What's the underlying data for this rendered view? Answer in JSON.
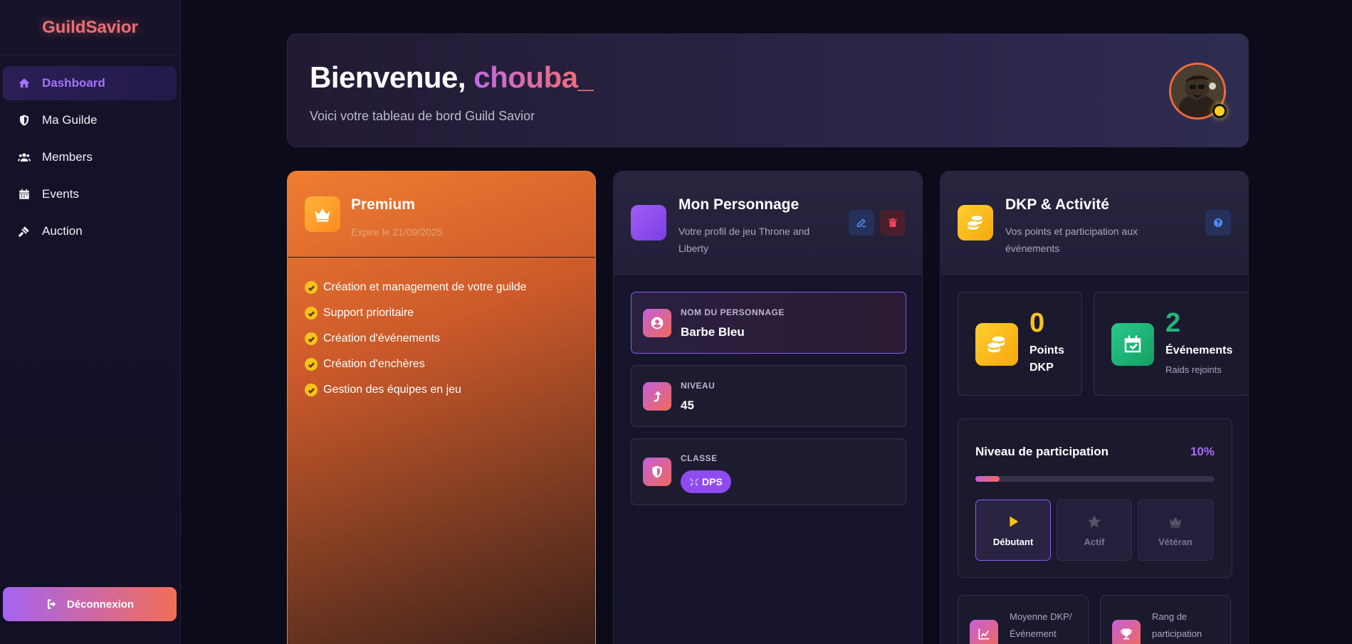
{
  "app": {
    "brand": "GuildSavior"
  },
  "sidebar": {
    "items": [
      {
        "label": "Dashboard",
        "icon": "home-icon",
        "active": true
      },
      {
        "label": "Ma Guilde",
        "icon": "shield-icon"
      },
      {
        "label": "Members",
        "icon": "users-icon"
      },
      {
        "label": "Events",
        "icon": "calendar-icon"
      },
      {
        "label": "Auction",
        "icon": "gavel-icon"
      }
    ],
    "logout_label": "Déconnexion"
  },
  "header": {
    "greeting": "Bienvenue, ",
    "username": "chouba_",
    "subtitle": "Voici votre tableau de bord Guild Savior",
    "status_color": "#f7d21c"
  },
  "premium": {
    "title": "Premium",
    "expiry": "Expire le 21/09/2025",
    "features": [
      "Création et management de votre guilde",
      "Support prioritaire",
      "Création d'événements",
      "Création d'enchères",
      "Gestion des équipes en jeu"
    ]
  },
  "character": {
    "title": "Mon Personnage",
    "subtitle": "Votre profil de jeu Throne and Liberty",
    "name_label": "NOM DU PERSONNAGE",
    "name": "Barbe Bleu",
    "level_label": "NIVEAU",
    "level": "45",
    "class_label": "CLASSE",
    "class": "DPS"
  },
  "dkp": {
    "title": "DKP & Activité",
    "subtitle": "Vos points et participation aux événements",
    "points": "0",
    "points_label": "Points DKP",
    "events": "2",
    "events_label": "Événements",
    "events_sub": "Raids rejoints",
    "participation_title": "Niveau de participation",
    "participation_pct": "10%",
    "participation_value": 0.1,
    "levels": [
      "Débutant",
      "Actif",
      "Vétéran"
    ],
    "avg_label": "Moyenne DKP/ Événement",
    "rank_label": "Rang de participation"
  },
  "colors": {
    "accent_purple": "#a274ff",
    "accent_orange": "#f07d31",
    "gold": "#f6c31a",
    "green": "#22b67a"
  }
}
